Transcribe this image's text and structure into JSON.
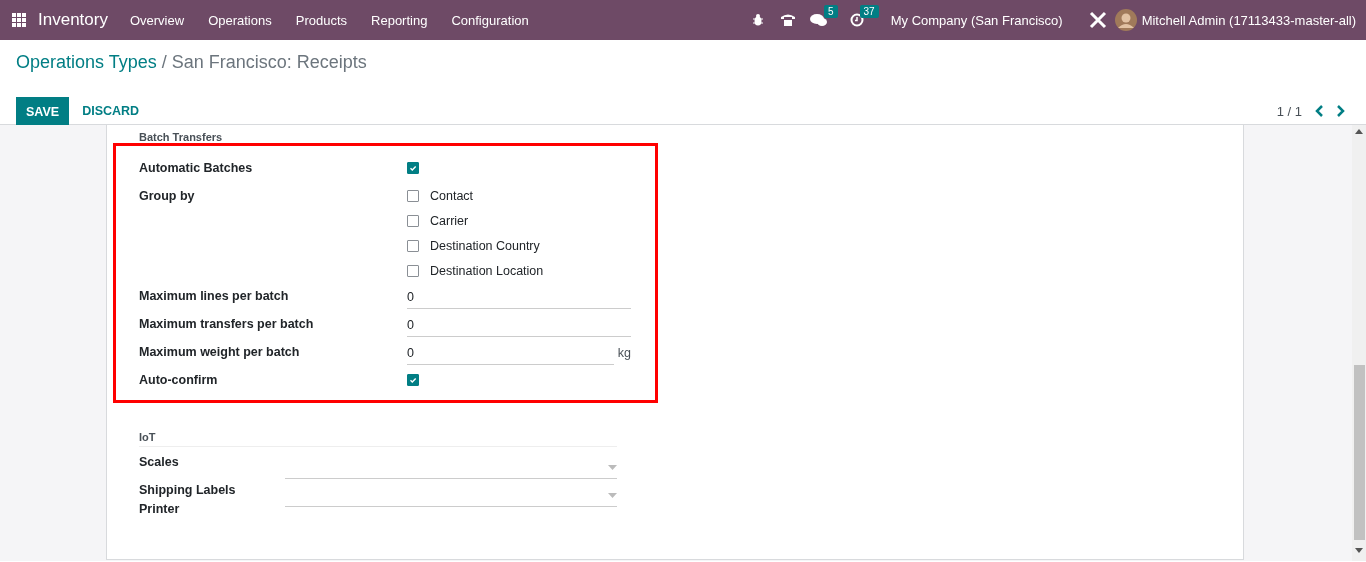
{
  "navbar": {
    "app_name": "Inventory",
    "menu": [
      "Overview",
      "Operations",
      "Products",
      "Reporting",
      "Configuration"
    ],
    "messages_badge": "5",
    "activities_badge": "37",
    "company": "My Company (San Francisco)",
    "user": "Mitchell Admin (17113433-master-all)"
  },
  "breadcrumb": {
    "parent": "Operations Types",
    "separator": "/",
    "current": "San Francisco: Receipts"
  },
  "buttons": {
    "save": "SAVE",
    "discard": "DISCARD"
  },
  "pager": "1 / 1",
  "batch_section": {
    "title": "Batch Transfers",
    "rows": [
      {
        "kind": "checkbox",
        "label": "Automatic Batches",
        "checked": true
      },
      {
        "kind": "checkgroup",
        "label": "Group by",
        "options": [
          {
            "label": "Contact",
            "checked": false
          },
          {
            "label": "Carrier",
            "checked": false
          },
          {
            "label": "Destination Country",
            "checked": false
          },
          {
            "label": "Destination Location",
            "checked": false
          }
        ]
      },
      {
        "kind": "number",
        "label": "Maximum lines per batch",
        "value": "0"
      },
      {
        "kind": "number",
        "label": "Maximum transfers per batch",
        "value": "0"
      },
      {
        "kind": "number",
        "label": "Maximum weight per batch",
        "value": "0",
        "unit": "kg"
      },
      {
        "kind": "checkbox",
        "label": "Auto-confirm",
        "checked": true
      }
    ]
  },
  "iot_section": {
    "title": "IoT",
    "rows": [
      {
        "label": "Scales"
      },
      {
        "label": "Shipping Labels Printer"
      }
    ]
  }
}
